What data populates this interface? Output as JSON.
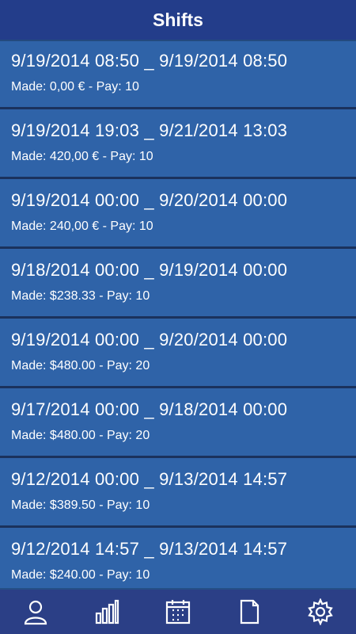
{
  "header": {
    "title": "Shifts"
  },
  "shifts": [
    {
      "range": "9/19/2014 08:50 _ 9/19/2014 08:50",
      "meta": "Made: 0,00 € - Pay: 10"
    },
    {
      "range": "9/19/2014 19:03 _ 9/21/2014 13:03",
      "meta": "Made: 420,00 € - Pay: 10"
    },
    {
      "range": "9/19/2014 00:00 _ 9/20/2014 00:00",
      "meta": "Made: 240,00 € - Pay: 10"
    },
    {
      "range": "9/18/2014 00:00 _ 9/19/2014 00:00",
      "meta": "Made: $238.33 - Pay: 10"
    },
    {
      "range": "9/19/2014 00:00 _ 9/20/2014 00:00",
      "meta": "Made: $480.00 - Pay: 20"
    },
    {
      "range": "9/17/2014 00:00 _ 9/18/2014 00:00",
      "meta": "Made: $480.00 - Pay: 20"
    },
    {
      "range": "9/12/2014 00:00 _ 9/13/2014 14:57",
      "meta": "Made: $389.50 - Pay: 10"
    },
    {
      "range": "9/12/2014 14:57 _ 9/13/2014 14:57",
      "meta": "Made: $240.00 - Pay: 10"
    }
  ],
  "bottom_nav": [
    {
      "icon": "user-icon"
    },
    {
      "icon": "bar-chart-icon"
    },
    {
      "icon": "calendar-icon"
    },
    {
      "icon": "document-icon"
    },
    {
      "icon": "gear-icon"
    }
  ],
  "colors": {
    "header_bg": "#233d8a",
    "item_bg": "#2f63a8",
    "nav_bg": "#2b3f86",
    "text": "#ffffff"
  }
}
